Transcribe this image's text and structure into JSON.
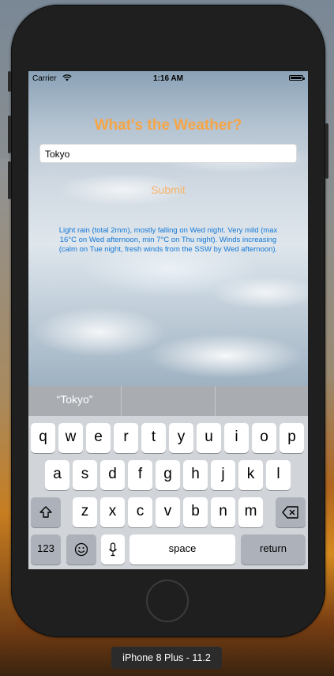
{
  "status_bar": {
    "carrier": "Carrier",
    "time": "1:16 AM"
  },
  "app": {
    "title": "What's the Weather?",
    "city_input": {
      "value": "Tokyo"
    },
    "submit_label": "Submit",
    "forecast": "Light rain (total 2mm), mostly falling on Wed night. Very mild (max 16°C on Wed afternoon, min 7°C on Thu night). Winds increasing (calm on Tue night, fresh winds from the SSW by Wed afternoon)."
  },
  "keyboard": {
    "suggestions": [
      "“Tokyo”",
      "",
      ""
    ],
    "row1": [
      "q",
      "w",
      "e",
      "r",
      "t",
      "y",
      "u",
      "i",
      "o",
      "p"
    ],
    "row2": [
      "a",
      "s",
      "d",
      "f",
      "g",
      "h",
      "j",
      "k",
      "l"
    ],
    "row3": [
      "z",
      "x",
      "c",
      "v",
      "b",
      "n",
      "m"
    ],
    "numbers_label": "123",
    "space_label": "space",
    "return_label": "return",
    "icons": {
      "shift": "shift-icon",
      "delete": "backspace-icon",
      "emoji": "emoji-icon",
      "mic": "microphone-icon"
    }
  },
  "device_label": "iPhone 8 Plus - 11.2"
}
